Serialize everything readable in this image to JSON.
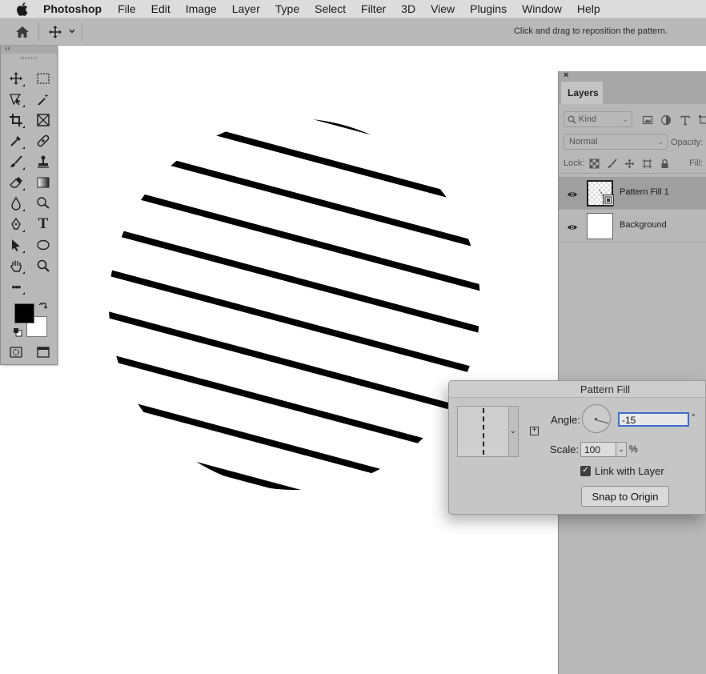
{
  "menubar": {
    "app_name": "Photoshop",
    "items": [
      "File",
      "Edit",
      "Image",
      "Layer",
      "Type",
      "Select",
      "Filter",
      "3D",
      "View",
      "Plugins",
      "Window",
      "Help"
    ]
  },
  "options": {
    "hint": "Click and drag to reposition the pattern."
  },
  "tools": {
    "collapse_glyph": "‹‹",
    "items": [
      "move-tool",
      "rect-marquee-tool",
      "object-select-tool",
      "magic-wand-tool",
      "crop-tool",
      "frame-tool",
      "eyedropper-tool",
      "healing-tool",
      "brush-tool",
      "stamp-tool",
      "eraser-tool",
      "gradient-tool",
      "blur-tool",
      "dodge-tool",
      "pen-tool",
      "type-tool",
      "path-select-tool",
      "ellipse-tool",
      "hand-tool",
      "zoom-tool",
      "more-tools"
    ],
    "type_tool_glyph": "T",
    "more_glyph": "•••",
    "foreground_color": "#000000",
    "background_color": "#ffffff"
  },
  "layers_panel": {
    "close_glyph": "×",
    "tab_label": "Layers",
    "kind_label": "Kind",
    "blend_mode": "Normal",
    "opacity_label": "Opacity:",
    "lock_label": "Lock:",
    "fill_label": "Fill:",
    "layers": [
      {
        "name": "Pattern Fill 1",
        "selected": true
      },
      {
        "name": "Background",
        "selected": false
      }
    ]
  },
  "dialog": {
    "title": "Pattern Fill",
    "angle_label": "Angle:",
    "angle_value": "-15",
    "degree_symbol": "°",
    "scale_label": "Scale:",
    "scale_value": "100",
    "percent": "%",
    "link_label": "Link with Layer",
    "link_checked": true,
    "snap_button": "Snap to Origin",
    "new_preset_glyph": "+",
    "dropdown_glyph": "⌄"
  }
}
